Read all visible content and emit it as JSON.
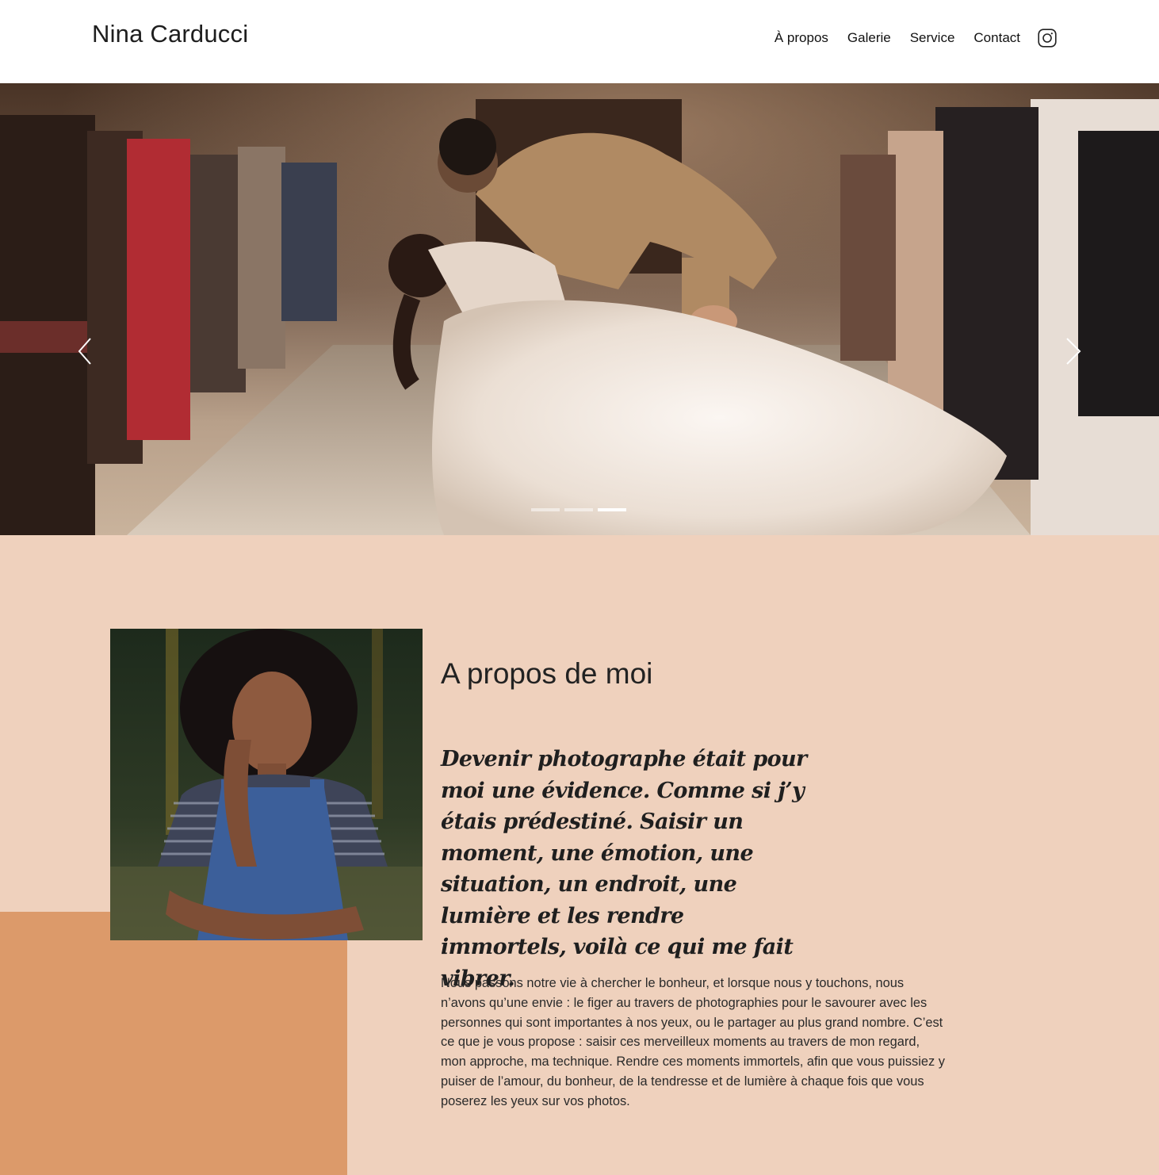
{
  "header": {
    "brand": "Nina Carducci",
    "nav": [
      {
        "label": "À propos"
      },
      {
        "label": "Galerie"
      },
      {
        "label": "Service"
      },
      {
        "label": "Contact"
      }
    ],
    "social_icon": "instagram-icon"
  },
  "carousel": {
    "slide_count": 3,
    "active_index": 2,
    "prev_icon": "chevron-left-icon",
    "next_icon": "chevron-right-icon"
  },
  "about": {
    "title": "A propos de moi",
    "quote": "Devenir photographe était pour moi une évidence. Comme si j’y étais prédestiné. Saisir un moment, une émotion, une situation, un endroit, une lumière et les rendre immortels, voilà ce qui me fait vibrer.",
    "text": "Nous passons notre vie à chercher le bonheur, et lorsque nous y touchons, nous n’avons qu’une envie : le figer au travers de photographies pour le savourer avec les personnes qui sont importantes à nos yeux, ou le partager au plus grand nombre. C’est ce que je vous propose : saisir ces merveilleux moments au travers de mon regard, mon approche, ma technique. Rendre ces moments immortels, afin que vous puissiez y puiser de l’amour, du bonheur, de la tendresse et de lumière à chaque fois que vous poserez les yeux sur vos photos."
  },
  "colors": {
    "about_background": "#efd1bd",
    "accent_block": "#dc9a6a",
    "text": "#1a1a1a"
  }
}
